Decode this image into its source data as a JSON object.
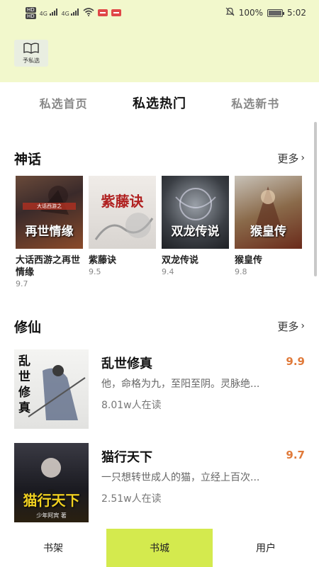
{
  "status_bar": {
    "battery": "100%",
    "time": "5:02",
    "hd1": "HD",
    "hd2": "HD",
    "net1": "4G",
    "net2": "4G"
  },
  "header": {
    "logo_icon": "book-icon",
    "logo_text": "予私选"
  },
  "tabs": [
    {
      "label": "私选首页"
    },
    {
      "label": "私选热门"
    },
    {
      "label": "私选新书"
    }
  ],
  "sections": {
    "myth": {
      "title": "神话",
      "more": "更多",
      "books": [
        {
          "title": "大话西游之再世情缘",
          "score": "9.7",
          "cover_text": "再世情缘",
          "cover_small": "大话西游之"
        },
        {
          "title": "紫藤诀",
          "score": "9.5",
          "cover_text": "紫藤诀",
          "cover_small": ""
        },
        {
          "title": "双龙传说",
          "score": "9.4",
          "cover_text": "双龙传说",
          "cover_small": ""
        },
        {
          "title": "猴皇传",
          "score": "9.8",
          "cover_text": "猴皇传",
          "cover_small": ""
        }
      ]
    },
    "xiuxian": {
      "title": "修仙",
      "more": "更多",
      "books": [
        {
          "title": "乱世修真",
          "score": "9.9",
          "desc": "他，命格为九，至阳至阴。灵脉绝...",
          "readers": "8.01w人在读",
          "cover_text": "乱世修真"
        },
        {
          "title": "猫行天下",
          "score": "9.7",
          "desc": "一只想转世成人的猫，立经上百次...",
          "readers": "2.51w人在读",
          "cover_text": "猫行天下",
          "cover_small": "少年阿宾 著"
        }
      ]
    }
  },
  "bottom_nav": [
    {
      "label": "书架"
    },
    {
      "label": "书城"
    },
    {
      "label": "用户"
    }
  ],
  "colors": {
    "accent": "#d4ea4e",
    "header_bg": "#f2f8cc",
    "score": "#e07a3a"
  }
}
